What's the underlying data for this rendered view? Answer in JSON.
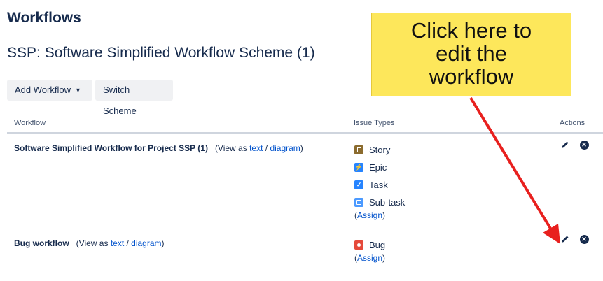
{
  "page": {
    "title": "Workflows",
    "scheme_title": "SSP: Software Simplified Workflow Scheme (1)"
  },
  "toolbar": {
    "add_workflow_label": "Add Workflow",
    "switch_scheme_label": "Switch Scheme"
  },
  "table": {
    "headers": {
      "workflow": "Workflow",
      "issue_types": "Issue Types",
      "actions": "Actions"
    },
    "rows": [
      {
        "workflow_name": "Software Simplified Workflow for Project SSP (1)",
        "view_prefix": "(View as ",
        "text_link": "text",
        "separator": " / ",
        "diagram_link": "diagram",
        "view_suffix": ")",
        "issue_types": [
          {
            "label": "Story",
            "icon": "story-icon",
            "color": "#8b6b2e"
          },
          {
            "label": "Epic",
            "icon": "epic-icon",
            "color": "#2684ff"
          },
          {
            "label": "Task",
            "icon": "task-icon",
            "color": "#2684ff"
          },
          {
            "label": "Sub-task",
            "icon": "subtask-icon",
            "color": "#4c9aff"
          }
        ],
        "assign_prefix": "(",
        "assign_link": "Assign",
        "assign_suffix": ")"
      },
      {
        "workflow_name": "Bug workflow",
        "view_prefix": "(View as ",
        "text_link": "text",
        "separator": " / ",
        "diagram_link": "diagram",
        "view_suffix": ")",
        "issue_types": [
          {
            "label": "Bug",
            "icon": "bug-icon",
            "color": "#e5493a"
          }
        ],
        "assign_prefix": "(",
        "assign_link": "Assign",
        "assign_suffix": ")"
      }
    ]
  },
  "callout": {
    "line1": "Click here to",
    "line2": "edit the",
    "line3": "workflow",
    "arrow_color": "#e8201e",
    "background": "#fde75b"
  }
}
